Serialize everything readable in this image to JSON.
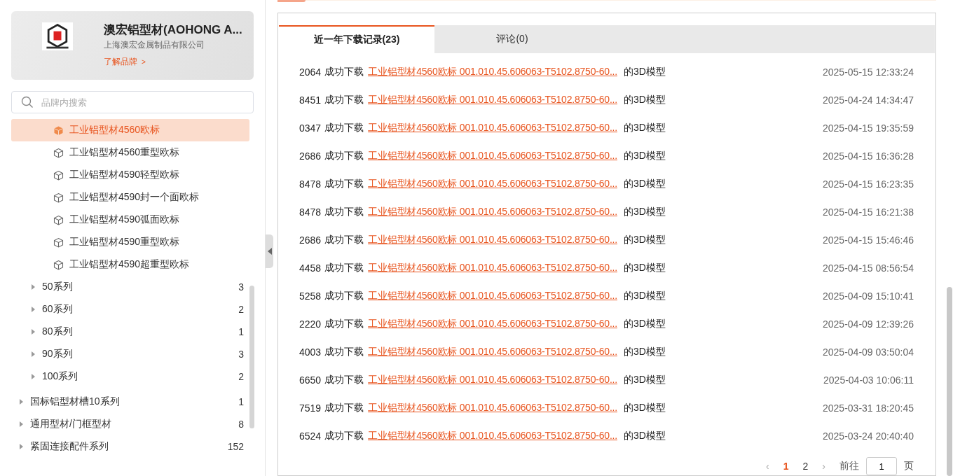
{
  "brand": {
    "name": "澳宏铝型材(AOHONG A...",
    "company": "上海澳宏金属制品有限公司",
    "link": "了解品牌",
    "link_arrow": ">"
  },
  "search": {
    "placeholder": "品牌内搜索"
  },
  "tree": [
    {
      "children": [
        {
          "children": [
            {
              "label": "工业铝型材4560欧标",
              "selected": true
            },
            {
              "label": "工业铝型材4560重型欧标",
              "selected": false
            },
            {
              "label": "工业铝型材4590轻型欧标",
              "selected": false
            },
            {
              "label": "工业铝型材4590封一个面欧标",
              "selected": false
            },
            {
              "label": "工业铝型材4590弧面欧标",
              "selected": false
            },
            {
              "label": "工业铝型材4590重型欧标",
              "selected": false
            },
            {
              "label": "工业铝型材4590超重型欧标",
              "selected": false
            }
          ]
        },
        {
          "label": "50系列",
          "count": "3",
          "expanded": false
        },
        {
          "label": "60系列",
          "count": "2",
          "expanded": false
        },
        {
          "label": "80系列",
          "count": "1",
          "expanded": false
        },
        {
          "label": "90系列",
          "count": "3",
          "expanded": false
        },
        {
          "label": "100系列",
          "count": "2",
          "expanded": false
        }
      ]
    },
    {
      "label": "国标铝型材槽10系列",
      "count": "1",
      "expanded": false
    },
    {
      "label": "通用型材/门框型材",
      "count": "8",
      "expanded": false
    },
    {
      "label": "紧固连接配件系列",
      "count": "152",
      "expanded": false
    }
  ],
  "tabs": [
    {
      "label": "近一年下载记录(23)",
      "selected": true
    },
    {
      "label": "评论(0)",
      "selected": false
    }
  ],
  "records": [
    {
      "user": "2064",
      "action": "成功下载",
      "link": "工业铝型材4560欧标 001.010.45.606063-T5102.8750-60...",
      "suffix": "的3D模型",
      "time": "2025-05-15 12:33:24"
    },
    {
      "user": "8451",
      "action": "成功下载",
      "link": "工业铝型材4560欧标 001.010.45.606063-T5102.8750-60...",
      "suffix": "的3D模型",
      "time": "2025-04-24 14:34:47"
    },
    {
      "user": "0347",
      "action": "成功下载",
      "link": "工业铝型材4560欧标 001.010.45.606063-T5102.8750-60...",
      "suffix": "的3D模型",
      "time": "2025-04-15 19:35:59"
    },
    {
      "user": "2686",
      "action": "成功下载",
      "link": "工业铝型材4560欧标 001.010.45.606063-T5102.8750-60...",
      "suffix": "的3D模型",
      "time": "2025-04-15 16:36:28"
    },
    {
      "user": "8478",
      "action": "成功下载",
      "link": "工业铝型材4560欧标 001.010.45.606063-T5102.8750-60...",
      "suffix": "的3D模型",
      "time": "2025-04-15 16:23:35"
    },
    {
      "user": "8478",
      "action": "成功下载",
      "link": "工业铝型材4560欧标 001.010.45.606063-T5102.8750-60...",
      "suffix": "的3D模型",
      "time": "2025-04-15 16:21:38"
    },
    {
      "user": "2686",
      "action": "成功下载",
      "link": "工业铝型材4560欧标 001.010.45.606063-T5102.8750-60...",
      "suffix": "的3D模型",
      "time": "2025-04-15 15:46:46"
    },
    {
      "user": "4458",
      "action": "成功下载",
      "link": "工业铝型材4560欧标 001.010.45.606063-T5102.8750-60...",
      "suffix": "的3D模型",
      "time": "2025-04-15 08:56:54"
    },
    {
      "user": "5258",
      "action": "成功下载",
      "link": "工业铝型材4560欧标 001.010.45.606063-T5102.8750-60...",
      "suffix": "的3D模型",
      "time": "2025-04-09 15:10:41"
    },
    {
      "user": "2220",
      "action": "成功下载",
      "link": "工业铝型材4560欧标 001.010.45.606063-T5102.8750-60...",
      "suffix": "的3D模型",
      "time": "2025-04-09 12:39:26"
    },
    {
      "user": "4003",
      "action": "成功下载",
      "link": "工业铝型材4560欧标 001.010.45.606063-T5102.8750-60...",
      "suffix": "的3D模型",
      "time": "2025-04-09 03:50:04"
    },
    {
      "user": "6650",
      "action": "成功下载",
      "link": "工业铝型材4560欧标 001.010.45.606063-T5102.8750-60...",
      "suffix": "的3D模型",
      "time": "2025-04-03 10:06:11"
    },
    {
      "user": "7519",
      "action": "成功下载",
      "link": "工业铝型材4560欧标 001.010.45.606063-T5102.8750-60...",
      "suffix": "的3D模型",
      "time": "2025-03-31 18:20:45"
    },
    {
      "user": "6524",
      "action": "成功下载",
      "link": "工业铝型材4560欧标 001.010.45.606063-T5102.8750-60...",
      "suffix": "的3D模型",
      "time": "2025-03-24 20:40:40"
    }
  ],
  "pagination": {
    "prev": "‹",
    "pages": [
      {
        "label": "1",
        "selected": true
      },
      {
        "label": "2",
        "selected": false
      }
    ],
    "next": "›",
    "goto": "前往",
    "page_value": "1",
    "page_unit": "页"
  }
}
